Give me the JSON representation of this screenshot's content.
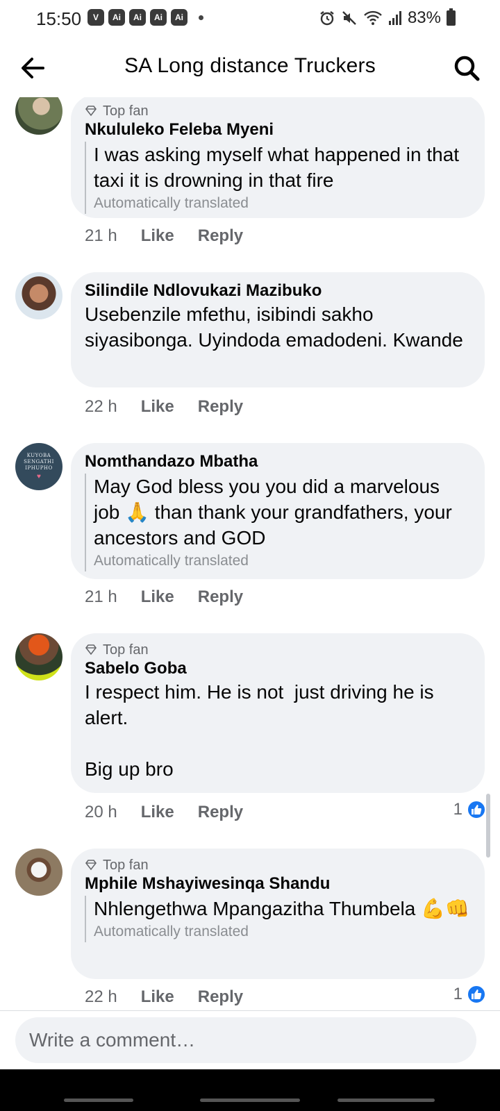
{
  "status_bar": {
    "time": "15:50",
    "app_icons": [
      "V",
      "Ai",
      "Ai",
      "Ai",
      "Ai"
    ],
    "battery": "83%"
  },
  "header": {
    "title": "SA Long distance Truckers",
    "back_icon": "arrow-left-icon",
    "search_icon": "search-icon"
  },
  "comments": [
    {
      "top_fan": "Top fan",
      "author": "Nkululeko Feleba Myeni",
      "text": "I was asking myself what happened in that taxi it is drowning in that fire",
      "translated": "Automatically translated",
      "time": "21 h",
      "like": "Like",
      "reply": "Reply"
    },
    {
      "author": "Silindile Ndlovukazi Mazibuko",
      "text": "Usebenzile mfethu, isibindi sakho siyasibonga. Uyindoda emadodeni. Kwande",
      "time": "22 h",
      "like": "Like",
      "reply": "Reply"
    },
    {
      "author": "Nomthandazo Mbatha",
      "avatar_text": "KUYOBA SENGATHI IPHUPHO",
      "text": "May God bless you you did a marvelous job 🙏 than thank your grandfathers, your ancestors and GOD",
      "translated": "Automatically translated",
      "time": "21 h",
      "like": "Like",
      "reply": "Reply"
    },
    {
      "top_fan": "Top fan",
      "author": "Sabelo Goba",
      "text": "I respect him. He is not  just driving he is alert.\n\nBig up bro",
      "time": "20 h",
      "like": "Like",
      "reply": "Reply",
      "reactions": "1"
    },
    {
      "top_fan": "Top fan",
      "author": "Mphile Mshayiwesinqa Shandu",
      "text": "Nhlengethwa Mpangazitha Thumbela 💪👊",
      "translated": "Automatically translated",
      "time": "22 h",
      "like": "Like",
      "reply": "Reply",
      "reactions": "1"
    }
  ],
  "composer": {
    "placeholder": "Write a comment…"
  },
  "colors": {
    "bubble": "#f0f2f5",
    "meta": "#65676b",
    "like_blue": "#1877f2"
  }
}
